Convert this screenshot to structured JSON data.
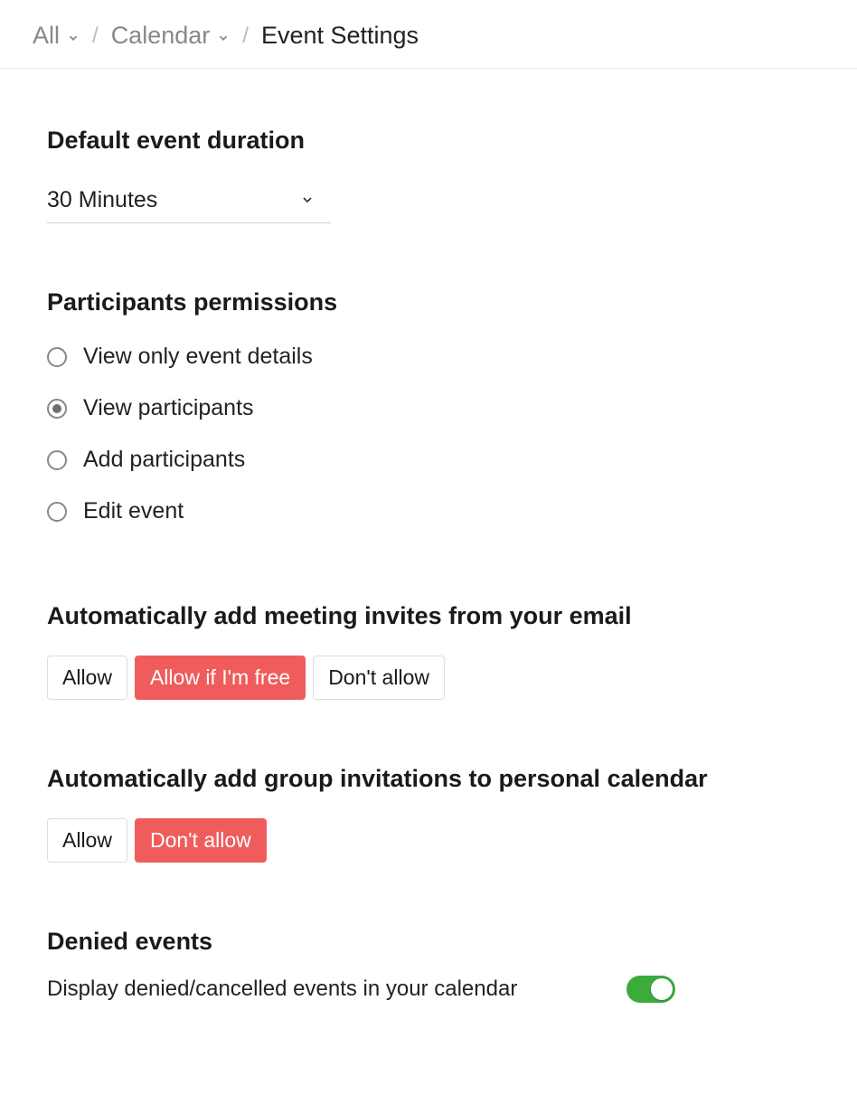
{
  "breadcrumb": {
    "root": "All",
    "mid": "Calendar",
    "current": "Event Settings"
  },
  "duration": {
    "title": "Default event duration",
    "selected": "30 Minutes"
  },
  "permissions": {
    "title": "Participants permissions",
    "options": [
      "View only event details",
      "View participants",
      "Add participants",
      "Edit event"
    ],
    "selected_index": 1
  },
  "meeting_invites": {
    "title": "Automatically add meeting invites from your email",
    "options": [
      "Allow",
      "Allow if I'm free",
      "Don't allow"
    ],
    "selected_index": 1
  },
  "group_invites": {
    "title": "Automatically add group invitations to personal calendar",
    "options": [
      "Allow",
      "Don't allow"
    ],
    "selected_index": 1
  },
  "denied": {
    "title": "Denied events",
    "label": "Display denied/cancelled events in your calendar",
    "toggle_on": true
  }
}
